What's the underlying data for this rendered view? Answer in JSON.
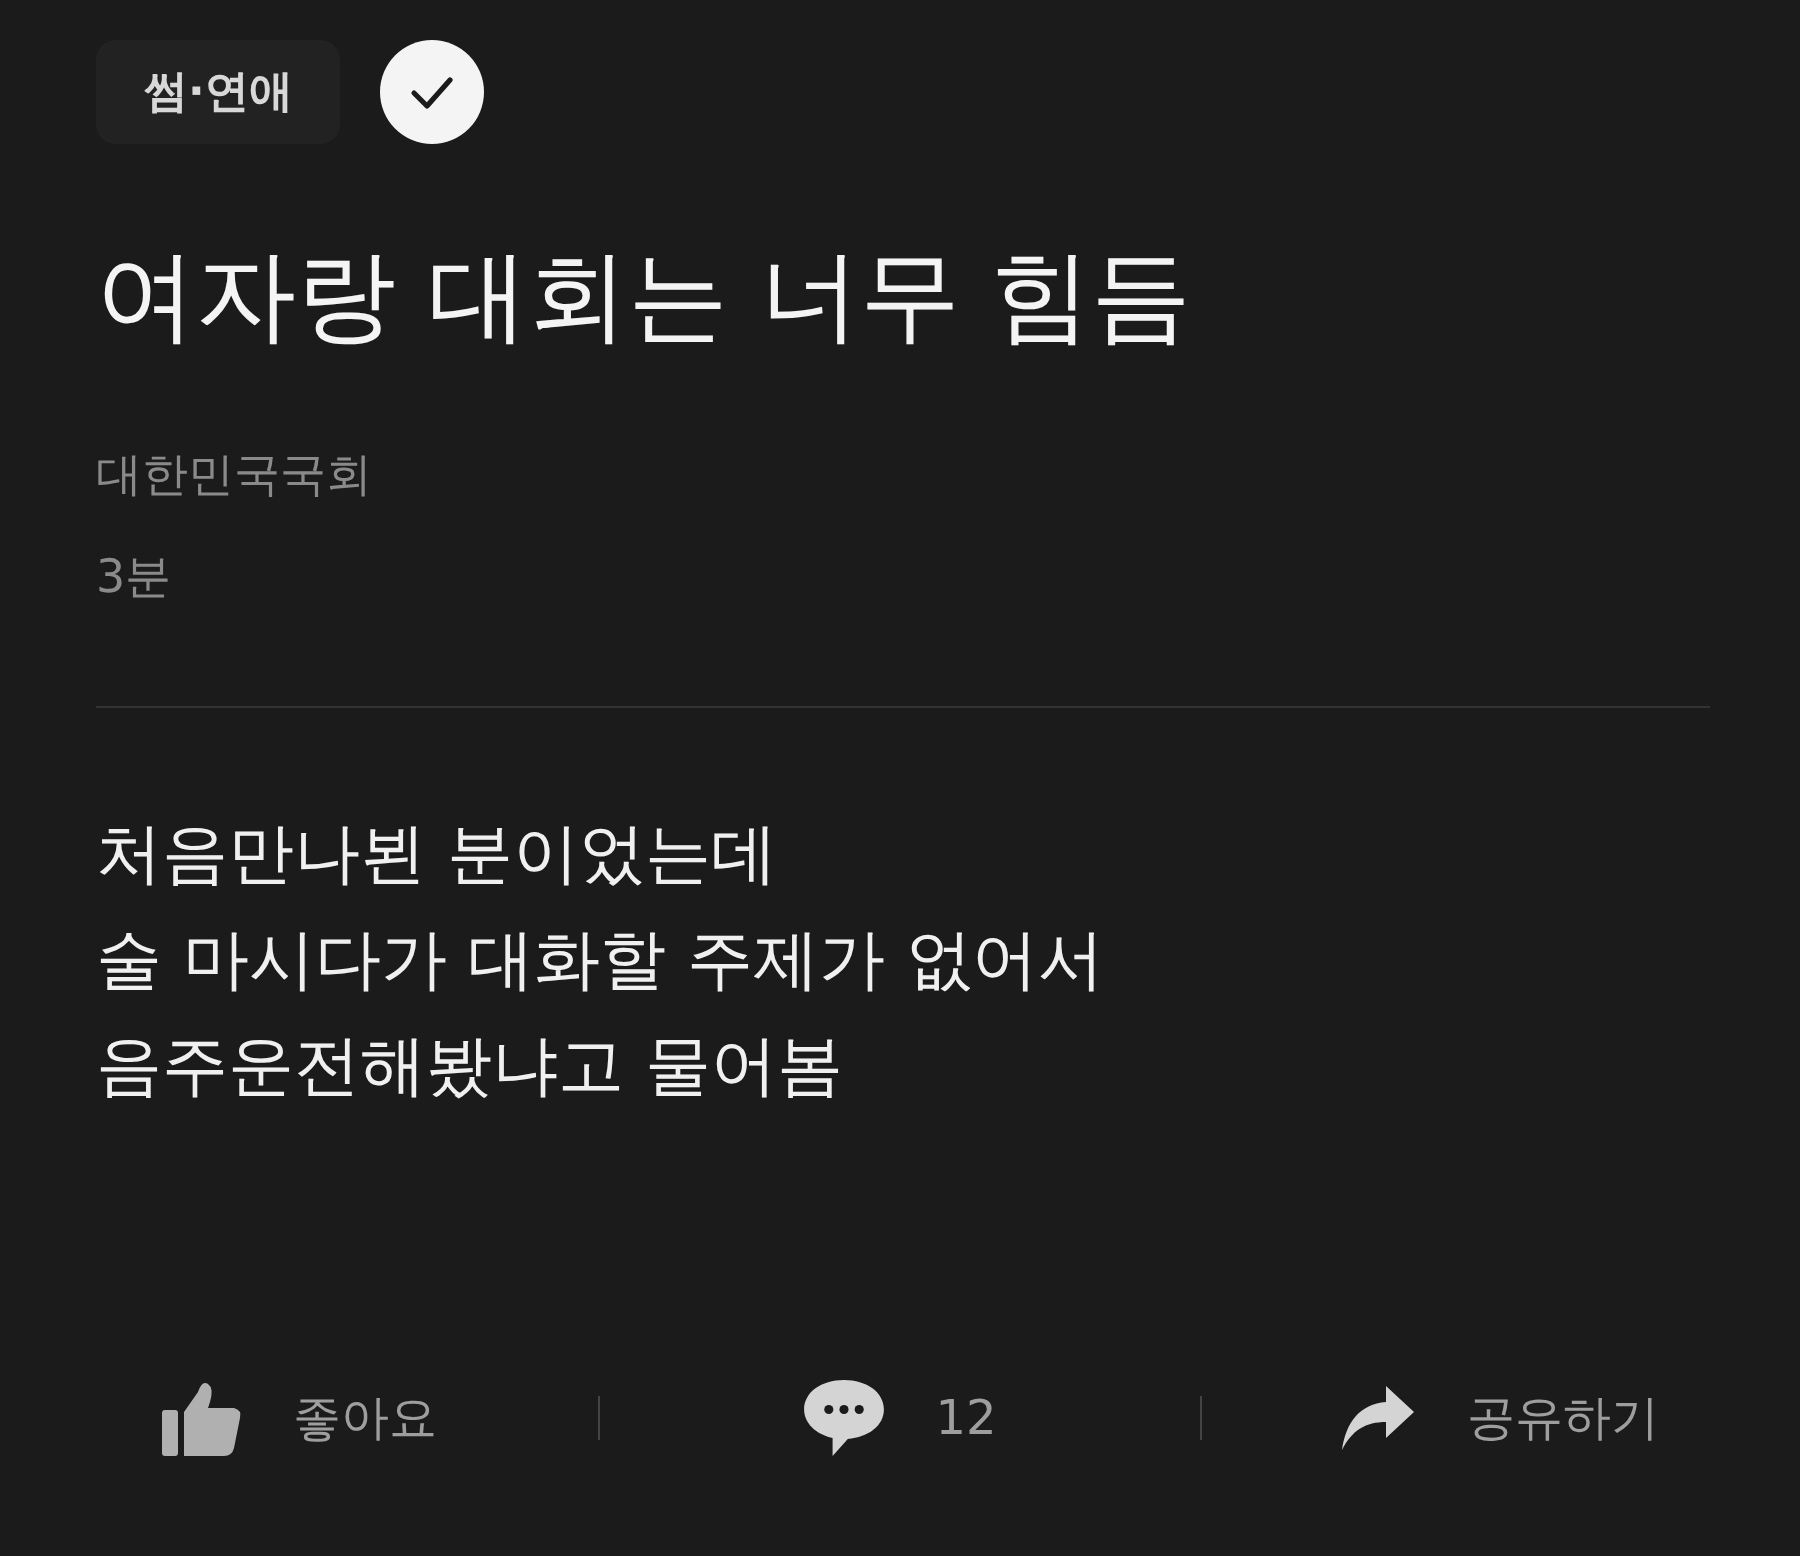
{
  "post": {
    "category": "썸·연애",
    "title": "여자랑 대회는 너무 힘듬",
    "author": "대한민국국회",
    "time": "3분",
    "body": [
      "처음만나뵌 분이었는데",
      "술 마시다가 대화할 주제가 없어서",
      "음주운전해봤냐고 물어봄"
    ]
  },
  "actions": [
    {
      "kind": "like",
      "label": "좋아요"
    },
    {
      "kind": "comment",
      "label": "12"
    },
    {
      "kind": "share",
      "label": "공유하기"
    }
  ]
}
